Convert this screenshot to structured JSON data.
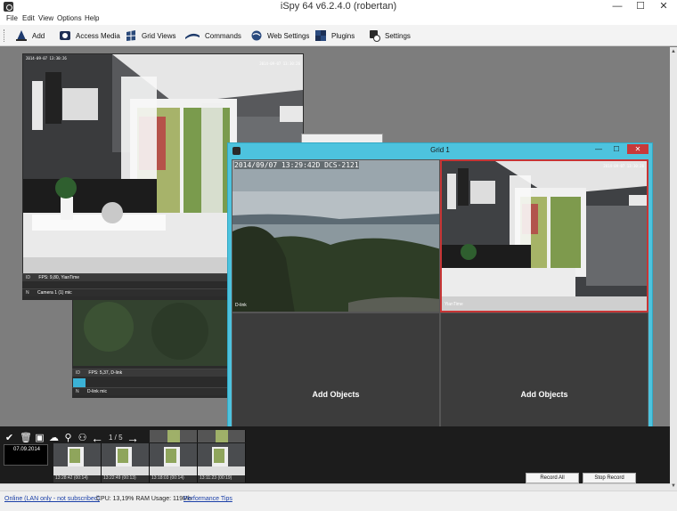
{
  "window": {
    "title": "iSpy 64 v6.2.4.0 (robertan)",
    "minimize": "—",
    "maximize": "☐",
    "close": "✕"
  },
  "menu": [
    "File",
    "Edit",
    "View",
    "Options",
    "Help"
  ],
  "toolbar": {
    "items": [
      {
        "label": "Add",
        "icon": "add-icon"
      },
      {
        "label": "Access Media",
        "icon": "access-media-icon"
      },
      {
        "label": "Grid Views",
        "icon": "grid-views-icon"
      },
      {
        "label": "Commands",
        "icon": "commands-icon"
      },
      {
        "label": "Web Settings",
        "icon": "web-settings-icon"
      },
      {
        "label": "Plugins",
        "icon": "plugins-icon"
      },
      {
        "label": "Settings",
        "icon": "settings-icon"
      }
    ]
  },
  "cameras": [
    {
      "timestamp": "2014-09-07 13:30:26",
      "status": {
        "id": "ID",
        "info": "FPS: 9,80, YianTime"
      },
      "name": {
        "prefix": "N",
        "label": "Camera 1 (1) mic"
      }
    },
    {
      "status": {
        "id": "ID",
        "info": "FPS: 5,37, D-link"
      },
      "name": {
        "prefix": "N",
        "label": "D-link mic"
      }
    }
  ],
  "grid": {
    "title": "Grid 1",
    "minimize": "—",
    "maximize": "☐",
    "close": "✕",
    "cells": [
      {
        "overlay": "2014/09/07 13:29:42D DCS-2121",
        "label": "D-link"
      },
      {
        "overlay": "2014-09-07 13:30:26",
        "label": "YianTime"
      },
      {
        "text": "Add Objects"
      },
      {
        "text": "Add Objects"
      }
    ]
  },
  "timeline": {
    "page": "1 / 5",
    "date": "07.09.2014",
    "thumbnails": [
      {
        "caption": "13:28:42 (00:14)"
      },
      {
        "caption": "13:22:49 (00:13)"
      },
      {
        "caption": "13:18:03 (00:14)"
      },
      {
        "caption": "13:11:23 (00:19)"
      }
    ],
    "record_all": "Record All",
    "stop_record": "Stop Record"
  },
  "status": {
    "online": "Online (LAN only - not subscribed)",
    "cpu": "CPU: 13,19% RAM Usage: 119Mb",
    "tips": "Performance Tips"
  },
  "colors": {
    "grid_frame": "#4dc3de",
    "selected_cell": "#c73535",
    "workspace": "#7d7d7d"
  }
}
